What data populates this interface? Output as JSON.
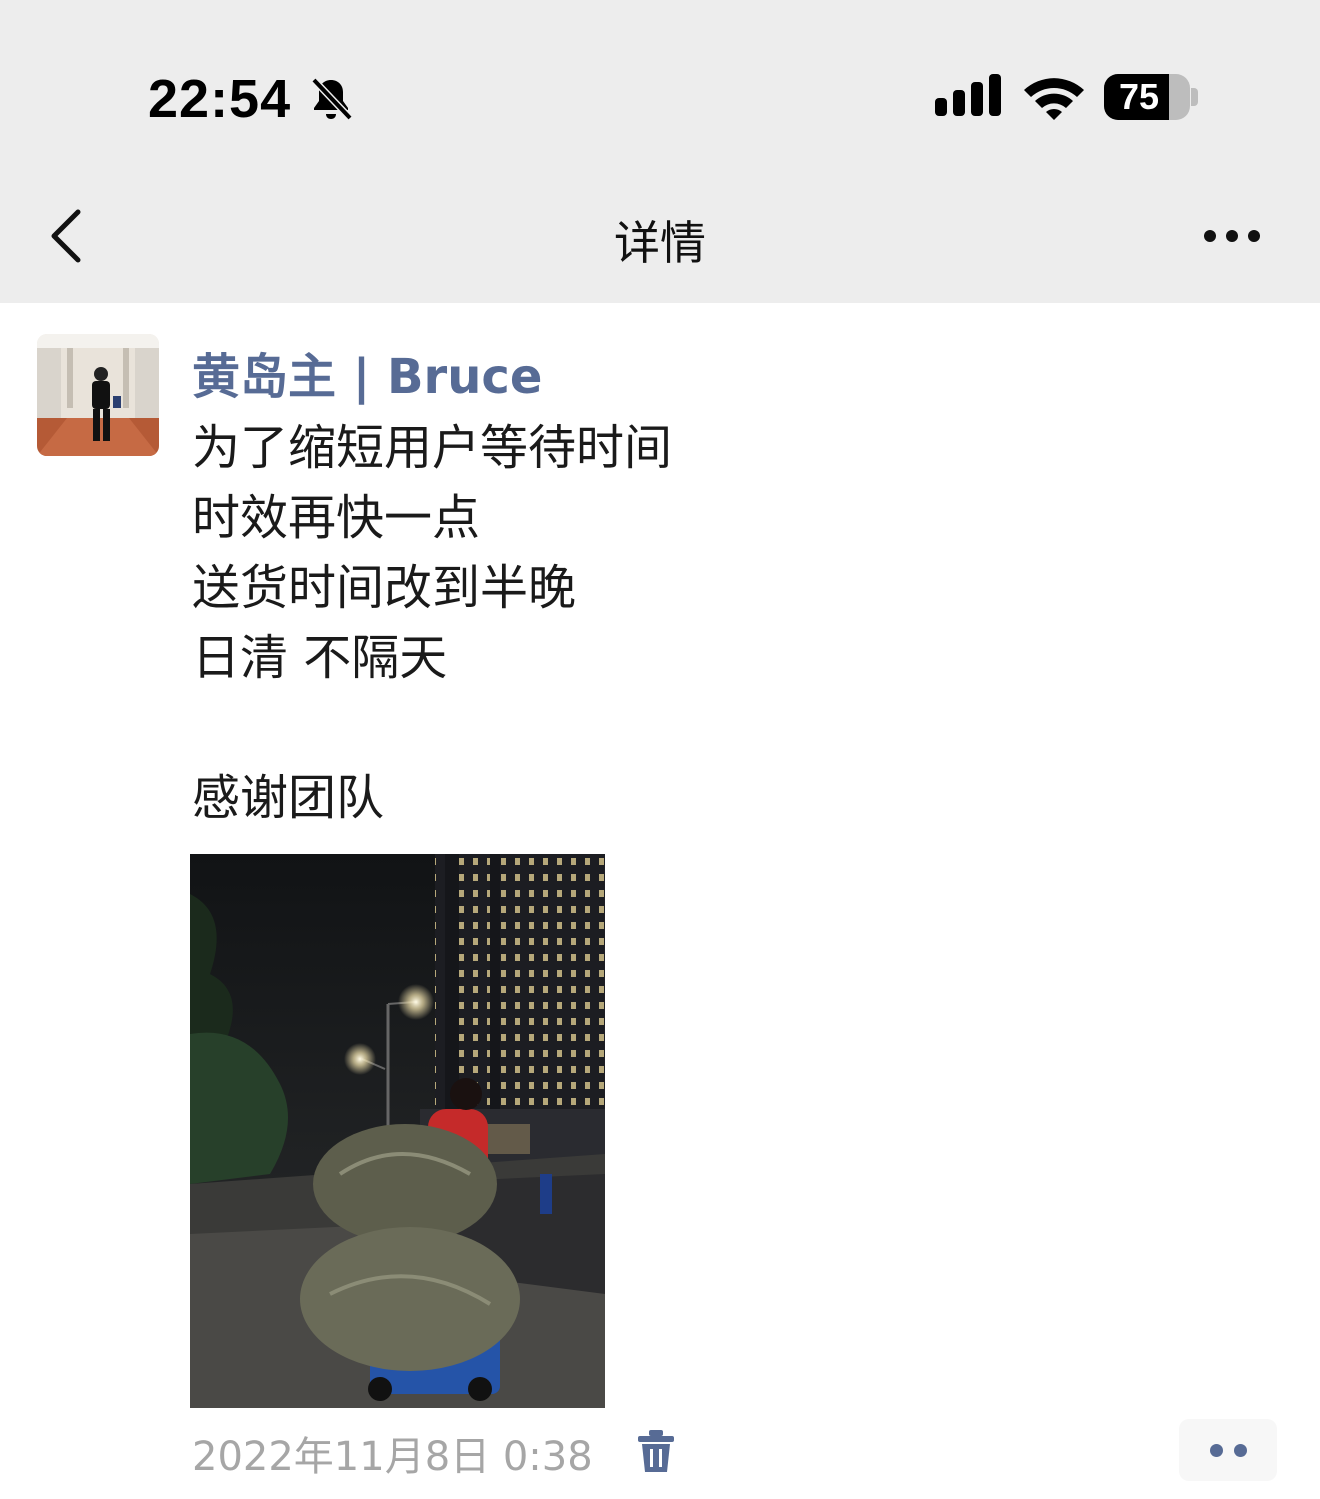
{
  "status_bar": {
    "time": "22:54",
    "battery_percent": "75",
    "battery_level": 0.75,
    "icons": [
      "bell-muted-icon",
      "cellular-signal-icon",
      "wifi-icon",
      "battery-icon"
    ]
  },
  "nav": {
    "title": "详情",
    "back_icon": "chevron-left-icon",
    "more_icon": "more-dots-icon"
  },
  "post": {
    "author": "黄岛主 | Bruce",
    "lines": [
      "为了缩短用户等待时间",
      "时效再快一点",
      "送货时间改到半晚",
      "日清 不隔天",
      "感谢团队"
    ],
    "timestamp": "2022年11月8日 0:38",
    "delete_icon": "trash-icon",
    "action_icon": "comment-like-dots-icon"
  },
  "colors": {
    "link": "#576b95",
    "nav_background": "#ededed",
    "timestamp": "#a6a6a6"
  }
}
